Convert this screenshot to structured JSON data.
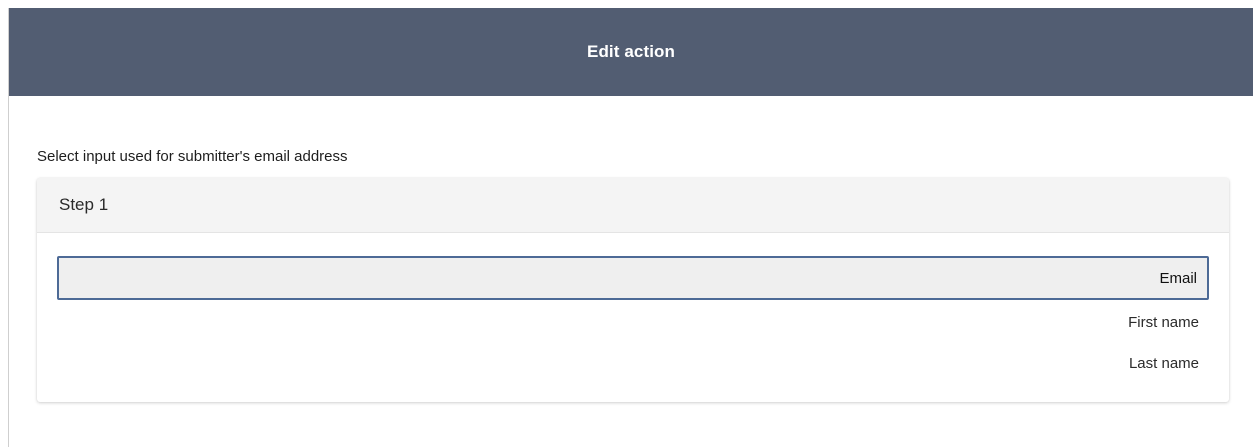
{
  "modal": {
    "title": "Edit action"
  },
  "form": {
    "prompt": "Select input used for submitter's email address",
    "step": {
      "title": "Step 1",
      "options": [
        {
          "label": "Email",
          "selected": true
        },
        {
          "label": "First name",
          "selected": false
        },
        {
          "label": "Last name",
          "selected": false
        }
      ]
    }
  },
  "colors": {
    "header_bg": "#525d72",
    "selected_border": "#4d6a96",
    "selected_bg": "#efefef"
  }
}
